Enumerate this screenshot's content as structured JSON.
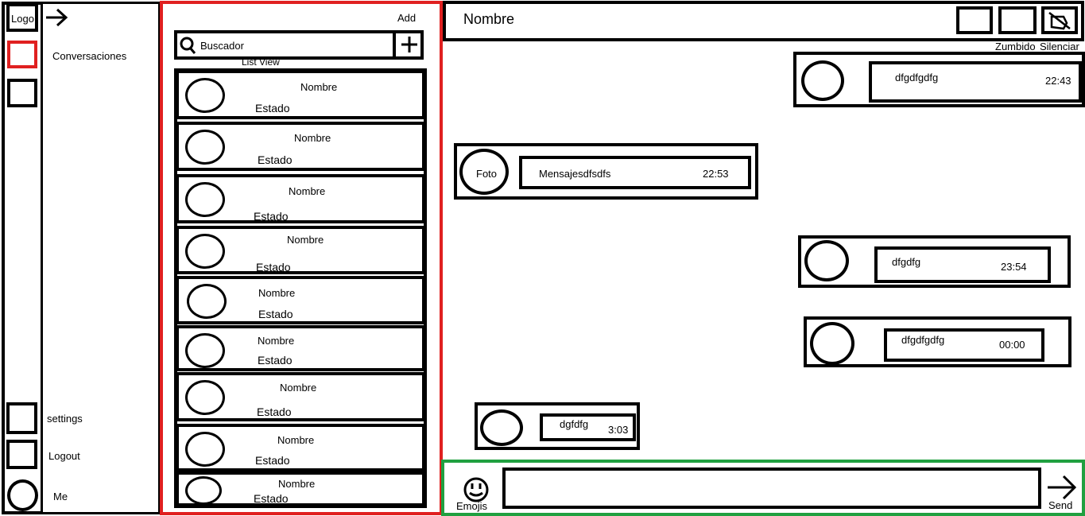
{
  "nav": {
    "logo": "Logo",
    "conversations_label": "Conversaciones",
    "settings_label": "settings",
    "logout_label": "Logout",
    "me_label": "Me",
    "active_color": "#e02020"
  },
  "list_panel": {
    "add_label": "Add",
    "search_placeholder": "Buscador",
    "list_view_label": "List View",
    "border_color": "#e02020",
    "items": [
      {
        "name": "Nombre",
        "status": "Estado"
      },
      {
        "name": "Nombre",
        "status": "Estado"
      },
      {
        "name": "Nombre",
        "status": "Estado"
      },
      {
        "name": "Nombre",
        "status": "Estado"
      },
      {
        "name": "Nombre",
        "status": "Estado"
      },
      {
        "name": "Nombre",
        "status": "Estado"
      },
      {
        "name": "Nombre",
        "status": "Estado"
      },
      {
        "name": "Nombre",
        "status": "Estado"
      },
      {
        "name": "Nombre",
        "status": "Estado"
      }
    ]
  },
  "chat": {
    "title": "Nombre",
    "buzz_label": "Zumbido",
    "mute_label": "Silenciar",
    "messages": [
      {
        "text": "dfgdfgdfg",
        "time": "22:43",
        "avatar": ""
      },
      {
        "text": "Mensajesdfsdfs",
        "time": "22:53",
        "avatar": "Foto"
      },
      {
        "text": "dfgdfg",
        "time": "23:54",
        "avatar": ""
      },
      {
        "text": "dfgdfgdfg",
        "time": "00:00",
        "avatar": ""
      },
      {
        "text": "dgfdfg",
        "time": "3:03",
        "avatar": ""
      }
    ]
  },
  "composer": {
    "emoji_label": "Emojis",
    "send_label": "Send",
    "input_value": "",
    "border_color": "#20a040"
  }
}
